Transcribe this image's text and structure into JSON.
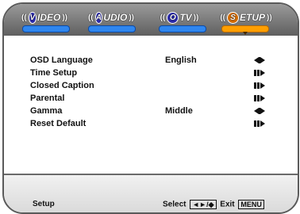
{
  "tabs": [
    {
      "label": "VIDEO",
      "cap": "V",
      "rest": "IDEO",
      "active": false
    },
    {
      "label": "AUDIO",
      "cap": "A",
      "rest": "UDIO",
      "active": false
    },
    {
      "label": "TV",
      "cap": "O",
      "rest": "TV",
      "active": false
    },
    {
      "label": "SETUP",
      "cap": "S",
      "rest": "ETUP",
      "active": true
    }
  ],
  "menu": [
    {
      "label": "OSD Language",
      "value": "English",
      "control": "left-right-icon"
    },
    {
      "label": "Time Setup",
      "value": "",
      "control": "enter-icon"
    },
    {
      "label": "Closed Caption",
      "value": "",
      "control": "enter-icon"
    },
    {
      "label": "Parental",
      "value": "",
      "control": "enter-icon"
    },
    {
      "label": "Gamma",
      "value": "Middle",
      "control": "left-right-icon"
    },
    {
      "label": "Reset Default",
      "value": "",
      "control": "enter-icon"
    }
  ],
  "footer": {
    "title": "Setup",
    "select_label": "Select",
    "select_keys": "◄►/◆",
    "exit_label": "Exit",
    "exit_key": "MENU"
  },
  "colors": {
    "tab_blue": "#2f86ef",
    "tab_orange": "#ff9f00"
  }
}
